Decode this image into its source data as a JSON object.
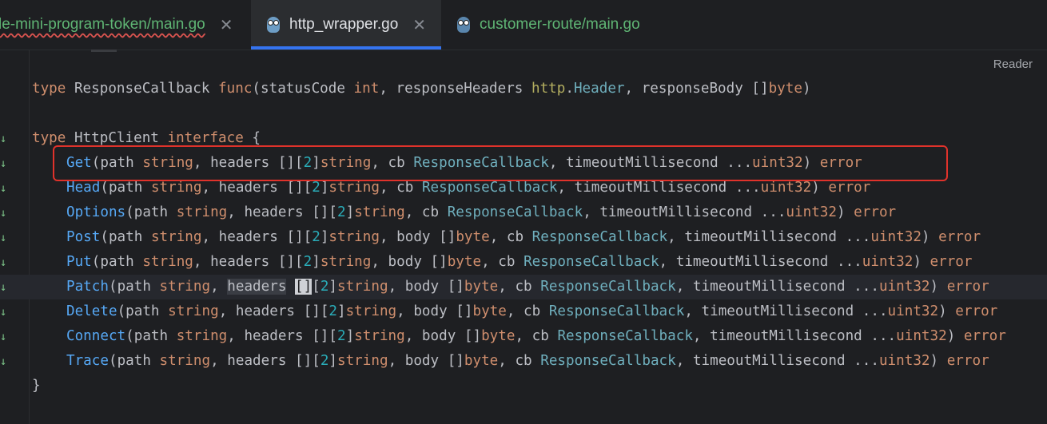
{
  "tabs": [
    {
      "label": "le-mini-program-token/main.go",
      "active": false
    },
    {
      "label": "http_wrapper.go",
      "active": true
    },
    {
      "label": "customer-route/main.go",
      "active": false
    }
  ],
  "reader_mode_label": "Reader",
  "code": {
    "l1": {
      "kw": "type",
      "name": " ResponseCallback ",
      "func": "func",
      "open": "(statusCode ",
      "int": "int",
      "p2": ", responseHeaders ",
      "pkg": "http",
      "dot": ".",
      "hdr": "Header",
      "p3": ", responseBody []",
      "byte": "byte",
      "close": ")"
    },
    "l2": {
      "kw": "type",
      "name": " HttpClient ",
      "iface": "interface",
      "brace": " {"
    },
    "methods": [
      {
        "name": "Get",
        "has_body": false
      },
      {
        "name": "Head",
        "has_body": false
      },
      {
        "name": "Options",
        "has_body": false
      },
      {
        "name": "Post",
        "has_body": true
      },
      {
        "name": "Put",
        "has_body": true
      },
      {
        "name": "Patch",
        "has_body": true
      },
      {
        "name": "Delete",
        "has_body": true
      },
      {
        "name": "Connect",
        "has_body": true
      },
      {
        "name": "Trace",
        "has_body": true
      }
    ],
    "tok": {
      "paren": "(",
      "path": "path ",
      "string": "string",
      "comma_headers": ", headers ",
      "headers_word": "headers",
      "brackets": "[]",
      "lb": "[",
      "two": "2",
      "rb": "]",
      "comma_body": ", body []",
      "byte": "byte",
      "comma_cb": ", cb ",
      "cbtype": "ResponseCallback",
      "comma_timeout": ", timeoutMillisecond ...",
      "uint32": "uint32",
      "close": ") ",
      "error": "error"
    },
    "end": "}"
  }
}
